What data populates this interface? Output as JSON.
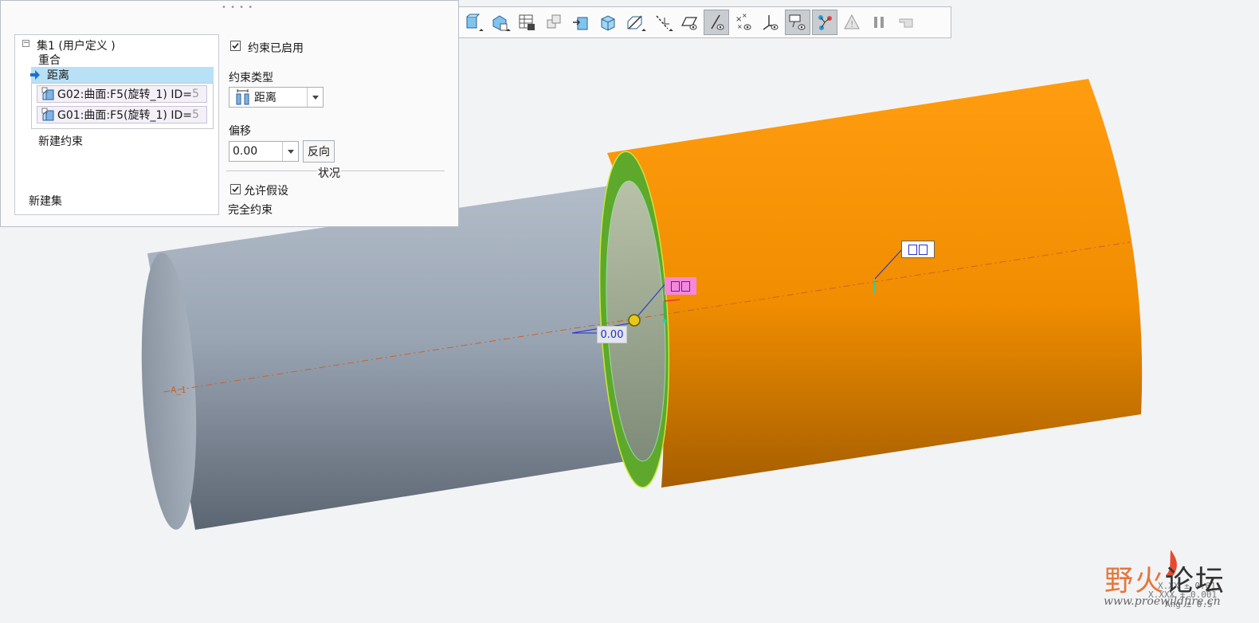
{
  "toolbar": {
    "buttons": [
      {
        "name": "plane-icon",
        "active": false,
        "has_menu": true
      },
      {
        "name": "axis-icon",
        "active": false,
        "has_menu": true
      },
      {
        "name": "table-icon",
        "active": false,
        "has_menu": false
      },
      {
        "name": "copy-geometry-icon",
        "active": false,
        "has_menu": false
      },
      {
        "name": "insert-icon",
        "active": false,
        "has_menu": false
      },
      {
        "name": "shaded-view-icon",
        "active": false,
        "has_menu": false
      },
      {
        "name": "datum-plane-icon",
        "active": false,
        "has_menu": true
      },
      {
        "name": "datum-axis-icon",
        "active": false,
        "has_menu": true
      },
      {
        "name": "plane-display-icon",
        "active": false,
        "has_menu": false
      },
      {
        "name": "axis-display-icon",
        "active": true,
        "has_menu": false
      },
      {
        "name": "point-display-icon",
        "active": false,
        "has_menu": false
      },
      {
        "name": "csys-display-icon",
        "active": false,
        "has_menu": false
      },
      {
        "name": "annotation-display-icon",
        "active": true,
        "has_menu": false
      },
      {
        "name": "connection-display-icon",
        "active": true,
        "has_menu": false
      },
      {
        "name": "warning-icon",
        "active": false,
        "has_menu": false
      },
      {
        "name": "pause-icon",
        "active": false,
        "has_menu": false
      },
      {
        "name": "snap-icon",
        "active": false,
        "has_menu": false
      }
    ]
  },
  "panel": {
    "tree": {
      "set_label": "集1 (用户定义 )",
      "constraint_coincident": "重合",
      "constraint_distance": "距离",
      "references": [
        {
          "text": "G02:曲面:F5(旋转_1) ID=",
          "trailing": "5"
        },
        {
          "text": "G01:曲面:F5(旋转_1) ID=",
          "trailing": "5"
        }
      ],
      "new_constraint": "新建约束",
      "new_set": "新建集"
    },
    "constraint_enabled": {
      "label": "约束已启用",
      "checked": true
    },
    "constraint_type": {
      "label": "约束类型",
      "value": "距离"
    },
    "offset": {
      "label": "偏移",
      "value": "0.00",
      "flip_label": "反向"
    },
    "status": {
      "label": "状况"
    },
    "allow_assumptions": {
      "label": "允许假设",
      "checked": true
    },
    "status_text": "完全约束"
  },
  "viewport": {
    "dimension_value": "0.00",
    "axis_label": "A_1",
    "colors": {
      "shaft_body": "#9aa6b5",
      "sleeve_body": "#f29100",
      "sleeve_rim": "#5ea82b",
      "axis_line": "#c9622a",
      "selected_tag_bg": "#f787d8"
    },
    "watermark": {
      "text_colored": "野火",
      "text_dark": "论坛",
      "url": "www.proewildfire.cn"
    },
    "corner_readouts": [
      "X.XX ± 0.01",
      "X.XXX ± 0.001",
      "Ang ± 0.5"
    ]
  }
}
